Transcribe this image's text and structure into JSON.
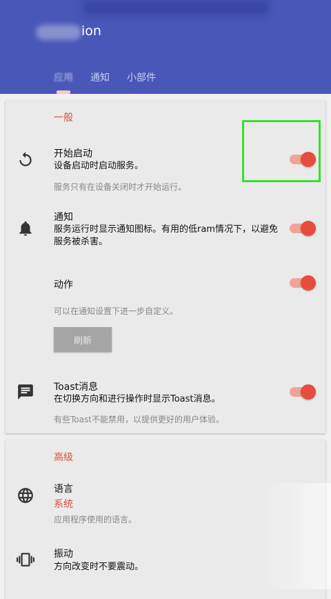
{
  "appbar": {
    "title": "ion",
    "tabs": [
      {
        "label": "应用"
      },
      {
        "label": "通知"
      },
      {
        "label": "小部件"
      }
    ]
  },
  "general": {
    "section_title": "一般",
    "start_on_boot": {
      "title": "开始启动",
      "desc": "设备启动时启动服务。",
      "hint": "服务只有在设备关闭时才开始运行。",
      "enabled": true,
      "icon": "restore-icon"
    },
    "notification": {
      "title": "通知",
      "desc": "服务运行时显示通知图标。有用的低ram情况下，以避免服务被杀害。",
      "enabled": true,
      "icon": "bell-icon"
    },
    "action": {
      "title": "动作",
      "hint": "可以在通知设置下进一步自定义。",
      "enabled": true,
      "refresh_label": "刷新"
    },
    "toast": {
      "title": "Toast消息",
      "desc": "在切换方向和进行操作时显示Toast消息。",
      "hint": "有些Toast不能禁用，以提供更好的用户体验。",
      "enabled": true,
      "icon": "message-icon"
    }
  },
  "advanced": {
    "section_title": "高级",
    "language": {
      "title": "语言",
      "value": "系统",
      "hint": "应用程序使用的语言。",
      "icon": "globe-icon"
    },
    "vibration": {
      "title": "振动",
      "desc": "方向改变时不要震动。",
      "icon": "vibration-icon"
    }
  },
  "colors": {
    "appbar": "#4857b8",
    "accent": "#e74c3c",
    "highlight": "#33e02d"
  }
}
